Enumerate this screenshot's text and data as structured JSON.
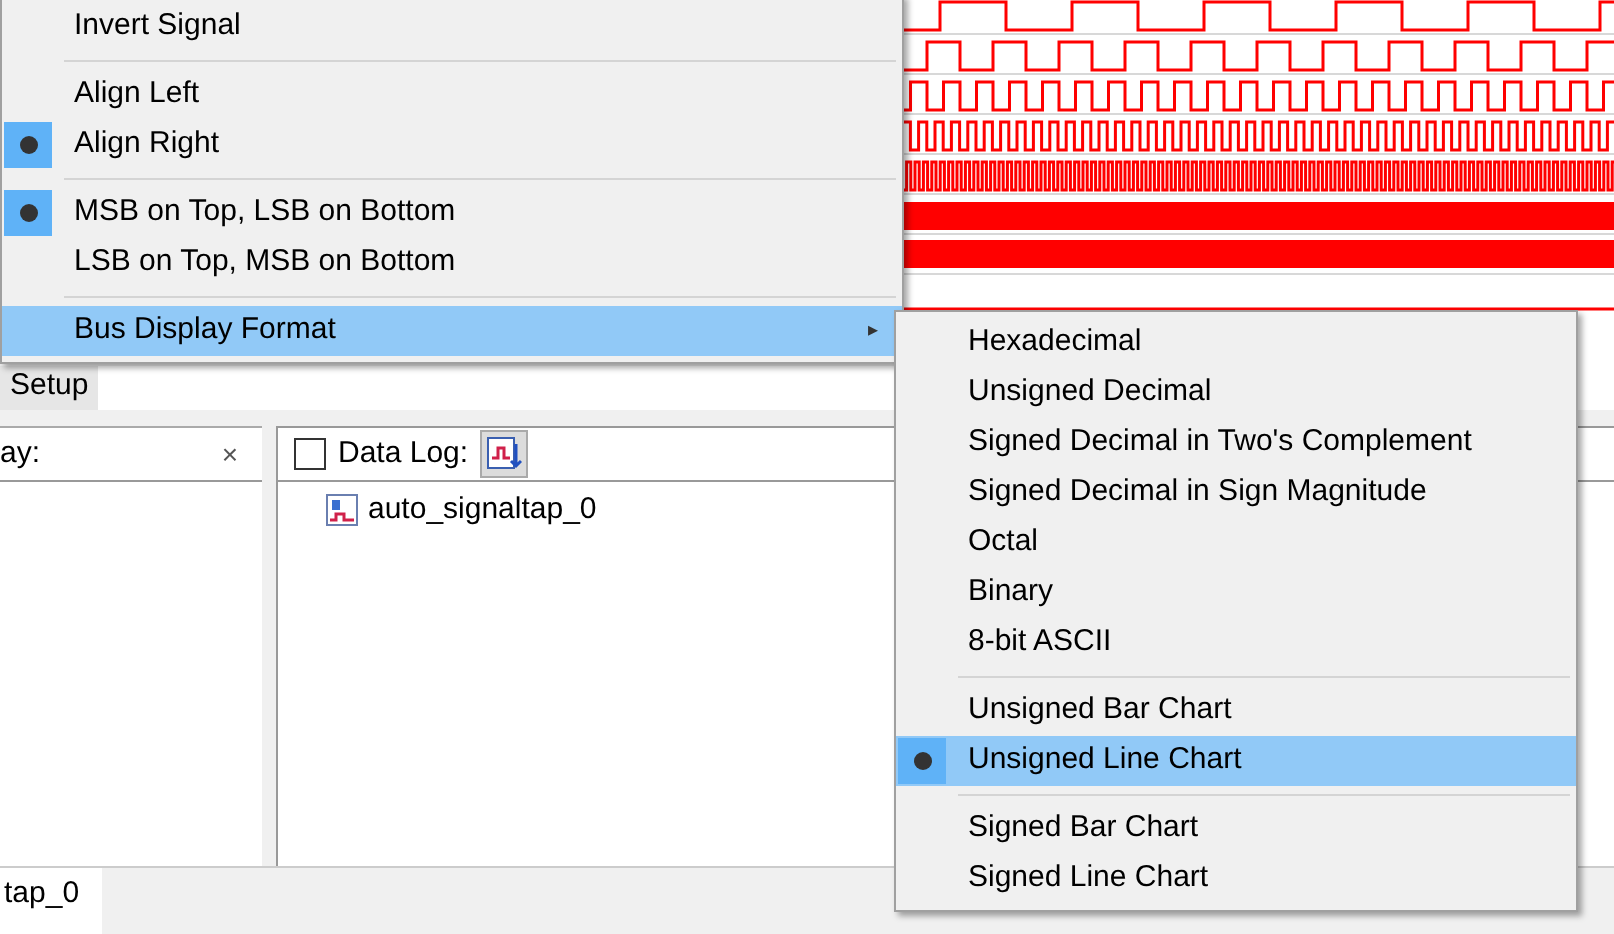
{
  "main_menu": {
    "items": [
      {
        "kind": "action",
        "label": "Invert Signal"
      },
      {
        "kind": "separator"
      },
      {
        "kind": "radio",
        "label": "Align Left",
        "selected": false
      },
      {
        "kind": "radio",
        "label": "Align Right",
        "selected": true
      },
      {
        "kind": "separator"
      },
      {
        "kind": "radio",
        "label": "MSB on Top, LSB on Bottom",
        "selected": true
      },
      {
        "kind": "radio",
        "label": "LSB on Top, MSB on Bottom",
        "selected": false
      },
      {
        "kind": "separator"
      },
      {
        "kind": "submenu",
        "label": "Bus Display Format",
        "highlighted": true,
        "arrow": "▸"
      }
    ]
  },
  "submenu": {
    "items": [
      {
        "kind": "radio",
        "label": "Hexadecimal",
        "selected": false,
        "highlighted": false
      },
      {
        "kind": "radio",
        "label": "Unsigned Decimal",
        "selected": false,
        "highlighted": false
      },
      {
        "kind": "radio",
        "label": "Signed Decimal in Two's Complement",
        "selected": false,
        "highlighted": false
      },
      {
        "kind": "radio",
        "label": "Signed Decimal in Sign Magnitude",
        "selected": false,
        "highlighted": false
      },
      {
        "kind": "radio",
        "label": "Octal",
        "selected": false,
        "highlighted": false
      },
      {
        "kind": "radio",
        "label": "Binary",
        "selected": false,
        "highlighted": false
      },
      {
        "kind": "radio",
        "label": "8-bit ASCII",
        "selected": false,
        "highlighted": false
      },
      {
        "kind": "separator"
      },
      {
        "kind": "radio",
        "label": "Unsigned Bar Chart",
        "selected": false,
        "highlighted": false
      },
      {
        "kind": "radio",
        "label": "Unsigned Line Chart",
        "selected": true,
        "highlighted": true
      },
      {
        "kind": "separator"
      },
      {
        "kind": "radio",
        "label": "Signed Bar Chart",
        "selected": false,
        "highlighted": false
      },
      {
        "kind": "radio",
        "label": "Signed Line Chart",
        "selected": false,
        "highlighted": false
      }
    ]
  },
  "top_tabs": [
    {
      "label": "Setup",
      "selected": false
    }
  ],
  "left_panel": {
    "title": "ay:",
    "close": "×"
  },
  "data_log": {
    "label": "Data Log:",
    "checked": false
  },
  "tree": [
    {
      "label": "auto_signaltap_0"
    }
  ],
  "bottom_tabs": [
    {
      "label": "tap_0",
      "selected": true
    }
  ]
}
